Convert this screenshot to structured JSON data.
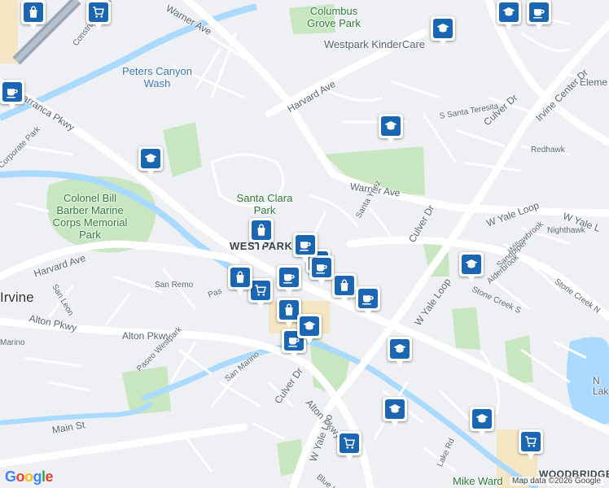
{
  "map": {
    "attribution": "Map data ©2026 Google",
    "logo": "Google",
    "labels": {
      "warner_ave_top": "Warner Ave",
      "warner_ave_mid": "Warner Ave",
      "construction_cir": "Construction Cir W",
      "columbus_grove_park": "Columbus Grove Park",
      "westpark_kindercare": "Westpark KinderCare",
      "elem": "Eleme",
      "peters_canyon_wash": "Peters Canyon Wash",
      "barranca_pkwy": "Barranca Pkwy",
      "harvard_ave_top": "Harvard Ave",
      "irvine_center_dr": "Irvine Center Dr",
      "culver_dr_top": "Culver Dr",
      "s_santa_teresita": "S Santa Teresita",
      "redhawk": "Redhawk",
      "corporate_park": "Corporate Park",
      "santa_clara_park": "Santa Clara Park",
      "colonel_park": "Colonel Bill Barber Marine Corps Memorial Park",
      "santa_ynez": "Santa Ynez",
      "w_yale_loop_top": "W Yale Loop",
      "w_yale_loop_right": "W Yale L",
      "nighthawk": "Nighthawk",
      "culver_dr_mid": "Culver Dr",
      "westpark": "WESTPARK",
      "harvard_ave_left": "Harvard Ave",
      "willowbrook": "Willowbrook",
      "sandpiper": "Sandpiper",
      "alderbrook": "Alderbrook",
      "stone_creek_s": "Stone Creek S",
      "stone_creek_n": "Stone Creek N",
      "san_leon": "San Leon",
      "san_remo": "San Remo",
      "paseo_left": "Pas",
      "irvine": "Irvine",
      "w_yale_loop_mid": "W Yale Loop",
      "alton_pkwy_left": "Alton Pkwy",
      "alton_pkwy_mid": "Alton Pkwy",
      "marino": "Marino",
      "paseo_westpark": "Paseo Westpark",
      "san_marino": "San Marino",
      "culver_dr_bottom": "Culver Dr",
      "alton_pkwy_bottom": "Alton Pkwy",
      "main_st": "Main St",
      "w_yale_loop_bottom": "W Yale Loo",
      "blue_l": "Blue L",
      "lake_rd": "Lake Rd",
      "mike_ward": "Mike Ward",
      "woodbridge": "WOODBRIDGE",
      "n_lake": "N Lak"
    },
    "colors": {
      "park": "#c8e6c0",
      "water": "#aadaff",
      "highway": "#9aa7b8",
      "major_road": "#ffffff",
      "shopping": "#f5e6c3",
      "marker": "#1a66b2"
    },
    "markers": [
      {
        "type": "shopping-bag-icon"
      },
      {
        "type": "cart-icon"
      },
      {
        "type": "coffee-icon"
      },
      {
        "type": "school-icon"
      },
      {
        "type": "coffee-icon"
      },
      {
        "type": "school-icon"
      },
      {
        "type": "school-icon"
      },
      {
        "type": "school-icon"
      },
      {
        "type": "shopping-bag-icon"
      },
      {
        "type": "shopping-bag-icon"
      },
      {
        "type": "coffee-icon"
      },
      {
        "type": "coffee-icon"
      },
      {
        "type": "cart-icon"
      },
      {
        "type": "shopping-bag-icon"
      },
      {
        "type": "coffee-icon"
      },
      {
        "type": "coffee-icon"
      },
      {
        "type": "shopping-bag-icon"
      },
      {
        "type": "school-icon"
      },
      {
        "type": "coffee-icon"
      },
      {
        "type": "school-icon"
      },
      {
        "type": "school-icon"
      },
      {
        "type": "school-icon"
      },
      {
        "type": "cart-icon"
      },
      {
        "type": "cart-icon"
      },
      {
        "type": "school-icon"
      },
      {
        "type": "coffee-icon"
      }
    ]
  }
}
